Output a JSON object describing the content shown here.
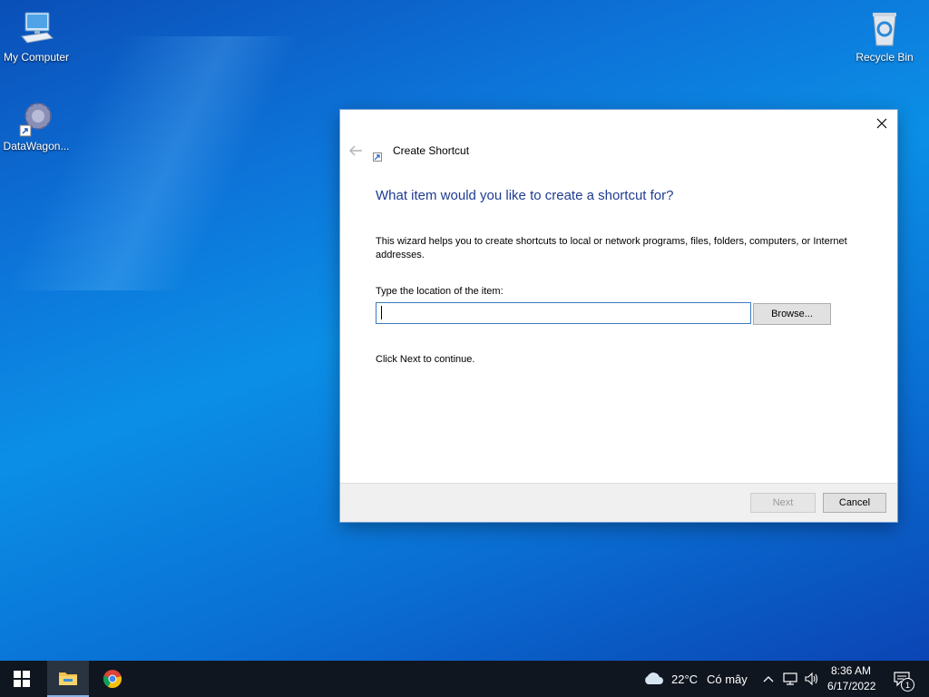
{
  "desktop": {
    "icons": [
      {
        "label": "My Computer"
      },
      {
        "label": "DataWagon..."
      },
      {
        "label": "Recycle Bin"
      }
    ]
  },
  "dialog": {
    "title": "Create Shortcut",
    "heading": "What item would you like to create a shortcut for?",
    "description": "This wizard helps you to create shortcuts to local or network programs, files, folders, computers, or Internet addresses.",
    "location_label": "Type the location of the item:",
    "location_value": "",
    "browse_label": "Browse...",
    "hint": "Click Next to continue.",
    "next_label": "Next",
    "cancel_label": "Cancel"
  },
  "taskbar": {
    "weather_temp": "22°C",
    "weather_text": "Có mây",
    "time": "8:36 AM",
    "date": "6/17/2022",
    "notification_count": "1"
  },
  "colors": {
    "heading": "#1f3d91",
    "accent": "#3b7bbf",
    "taskbar": "#101620"
  }
}
